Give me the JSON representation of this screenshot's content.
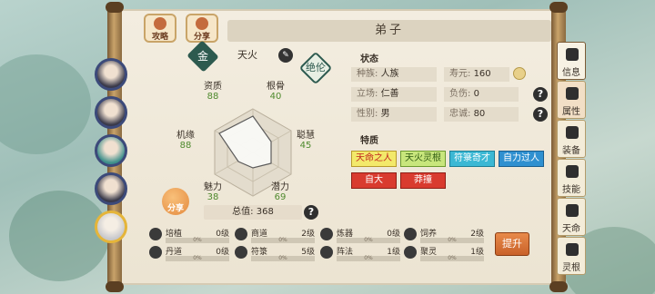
{
  "header": {
    "guide_label": "攻略",
    "share_label": "分享",
    "title": "弟子"
  },
  "character": {
    "badge_char": "金",
    "name": "天火",
    "seal_char": "绝伦",
    "stats": [
      {
        "name": "资质",
        "value": "88"
      },
      {
        "name": "根骨",
        "value": "40"
      },
      {
        "name": "聪慧",
        "value": "45"
      },
      {
        "name": "潜力",
        "value": "69"
      },
      {
        "name": "魅力",
        "value": "38"
      },
      {
        "name": "机缘",
        "value": "88"
      }
    ],
    "total_label": "总值:",
    "total_value": "368",
    "share_ball_label": "分享"
  },
  "status": {
    "section_title": "状态",
    "rows": [
      {
        "key": "种族:",
        "value": "人族"
      },
      {
        "key": "寿元:",
        "value": "160"
      },
      {
        "key": "立场:",
        "value": "仁善"
      },
      {
        "key": "负伤:",
        "value": "0"
      },
      {
        "key": "性别:",
        "value": "男"
      },
      {
        "key": "忠诚:",
        "value": "80"
      }
    ]
  },
  "traits": {
    "section_title": "特质",
    "items": [
      "天命之人",
      "天火灵根",
      "符箓奇才",
      "自力过人",
      "自大",
      "莽撞"
    ]
  },
  "skills": [
    {
      "name": "培植",
      "level": "0级",
      "progress": "0%"
    },
    {
      "name": "商道",
      "level": "2级",
      "progress": "0%"
    },
    {
      "name": "炼器",
      "level": "0级",
      "progress": "0%"
    },
    {
      "name": "饲养",
      "level": "2级",
      "progress": "0%"
    },
    {
      "name": "丹道",
      "level": "0级",
      "progress": "0%"
    },
    {
      "name": "符箓",
      "level": "5级",
      "progress": "0%"
    },
    {
      "name": "阵法",
      "level": "1级",
      "progress": "0%"
    },
    {
      "name": "聚灵",
      "level": "1级",
      "progress": "0%"
    }
  ],
  "upgrade_label": "提升",
  "right_tabs": [
    "信息",
    "属性",
    "装备",
    "技能",
    "天命",
    "灵根"
  ],
  "help_glyph": "?"
}
